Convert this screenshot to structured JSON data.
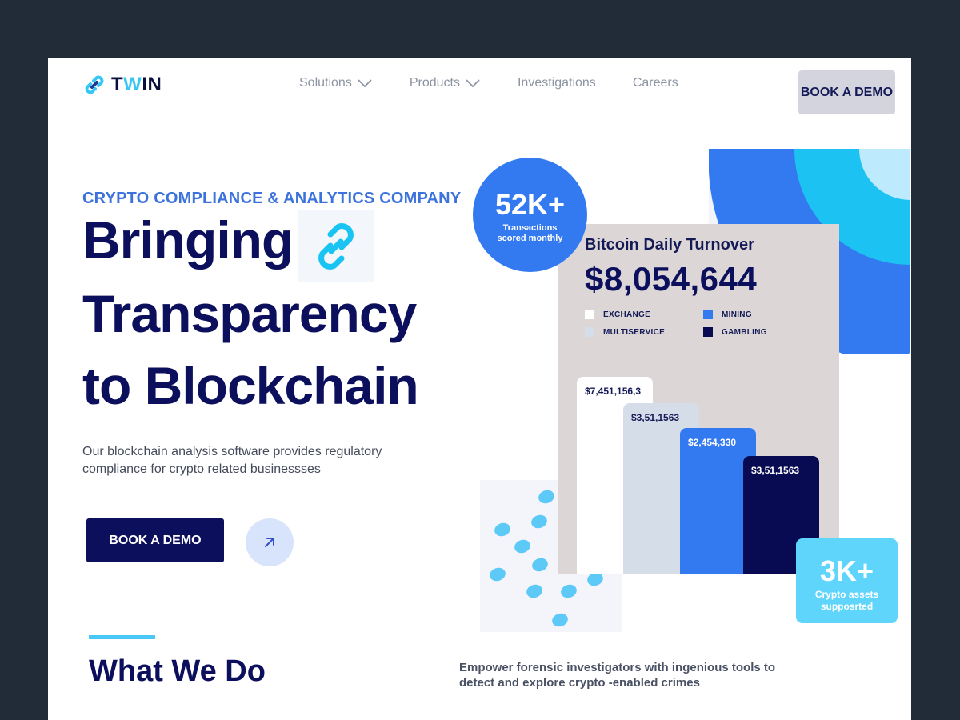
{
  "header": {
    "logo_text_prefix": "T",
    "logo_text_accent": "W",
    "logo_text_suffix": "IN",
    "nav": [
      {
        "label": "Solutions",
        "has_dropdown": true
      },
      {
        "label": "Products",
        "has_dropdown": true
      },
      {
        "label": "Investigations",
        "has_dropdown": false
      },
      {
        "label": "Careers",
        "has_dropdown": false
      }
    ],
    "cta_label": "BOOK A DEMO"
  },
  "hero": {
    "eyebrow": "CRYPTO COMPLIANCE & ANALYTICS COMPANY",
    "headline_line1": "Bringing",
    "headline_line2": "Transparency",
    "headline_line3": "to Blockchain",
    "description": "Our blockchain analysis software provides regulatory compliance for crypto related businessses",
    "cta_label": "BOOK A DEMO"
  },
  "stats": {
    "transactions_value": "52K+",
    "transactions_label": "Transactions scored monthly",
    "assets_value": "3K+",
    "assets_label": "Crypto assets supposrted"
  },
  "turnover": {
    "title": "Bitcoin Daily Turnover",
    "total": "$8,054,644",
    "legend": [
      {
        "label": "EXCHANGE",
        "color": "#ffffff"
      },
      {
        "label": "MINING",
        "color": "#3379f0"
      },
      {
        "label": "MULTISERVICE",
        "color": "#d5dde8"
      },
      {
        "label": "GAMBLING",
        "color": "#080b52"
      }
    ],
    "bars": [
      {
        "label": "$7,451,156,3",
        "color": "#ffffff",
        "text_color": "#141a56"
      },
      {
        "label": "$3,51,1563",
        "color": "#d5dde8",
        "text_color": "#141a56"
      },
      {
        "label": "$2,454,330",
        "color": "#3379f0",
        "text_color": "#ffffff"
      },
      {
        "label": "$3,51,1563",
        "color": "#080b52",
        "text_color": "#ffffff"
      }
    ]
  },
  "section": {
    "title": "What We Do",
    "description": "Empower forensic investigators with ingenious tools to detect and explore crypto -enabled crimes"
  },
  "colors": {
    "navy": "#0b0f5c",
    "brand_blue": "#3379f0",
    "cyan": "#5fd5fc",
    "background_frame": "#222b38"
  }
}
